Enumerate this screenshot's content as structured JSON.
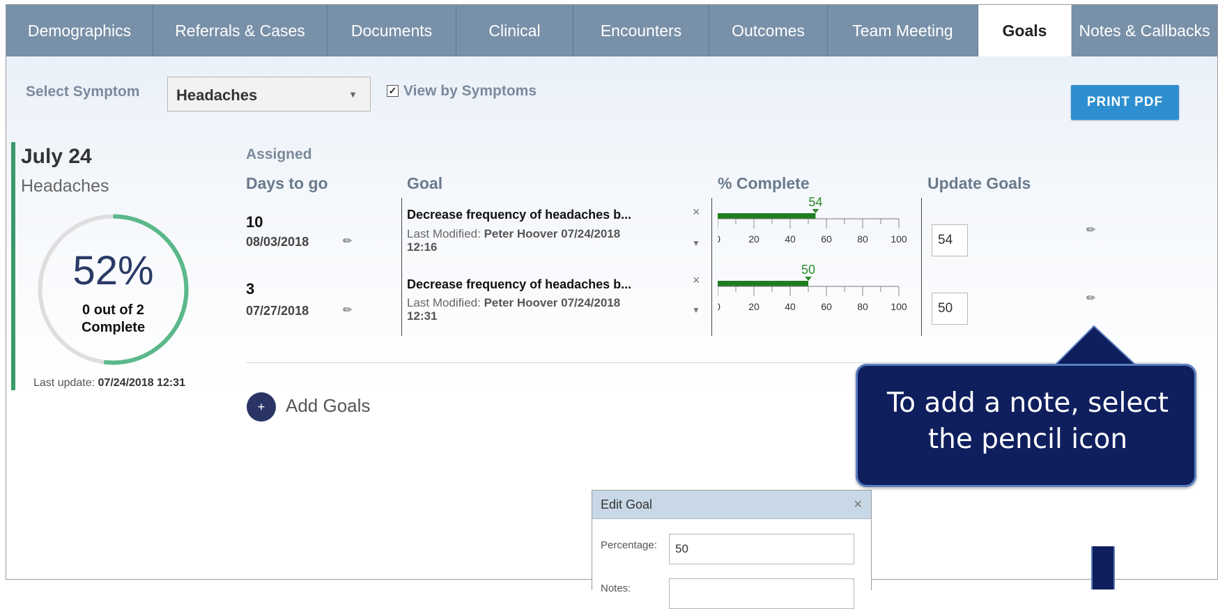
{
  "tabs": [
    "Demographics",
    "Referrals & Cases",
    "Documents",
    "Clinical",
    "Encounters",
    "Outcomes",
    "Team Meeting",
    "Goals",
    "Notes & Callbacks"
  ],
  "active_tab": "Goals",
  "toolbar": {
    "select_label": "Select Symptom",
    "select_value": "Headaches",
    "view_by_symptoms": "View by Symptoms",
    "view_by_symptoms_checked": true,
    "print_pdf": "PRINT PDF"
  },
  "summary": {
    "date": "July 24",
    "symptom": "Headaches",
    "percent": "52%",
    "percent_value": 52,
    "count_line1": "0 out of 2",
    "count_line2": "Complete",
    "last_update_label": "Last update:",
    "last_update_value": "07/24/2018 12:31"
  },
  "table": {
    "assigned_header": "Assigned",
    "days_header": "Days to go",
    "goal_header": "Goal",
    "complete_header": "% Complete",
    "update_header": "Update Goals",
    "scale_ticks": [
      "0",
      "20",
      "40",
      "60",
      "80",
      "100"
    ],
    "rows": [
      {
        "days": "10",
        "due": "08/03/2018",
        "goal": "Decrease frequency of headaches b...",
        "modified_label": "Last Modified:",
        "modified_by": "Peter Hoover 07/24/2018",
        "modified_time": "12:16",
        "percent": 54,
        "percent_label": "54",
        "update_value": "54"
      },
      {
        "days": "3",
        "due": "07/27/2018",
        "goal": "Decrease frequency of headaches b...",
        "modified_label": "Last Modified:",
        "modified_by": "Peter Hoover 07/24/2018",
        "modified_time": "12:31",
        "percent": 50,
        "percent_label": "50",
        "update_value": "50"
      }
    ]
  },
  "add_goals": "Add Goals",
  "dialog": {
    "title": "Edit Goal",
    "percentage_label": "Percentage:",
    "percentage_value": "50",
    "notes_label": "Notes:"
  },
  "callout": {
    "line1": "To add a note, select",
    "line2": "the pencil icon"
  },
  "colors": {
    "tab_bar": "#7890a8",
    "progress": "#1e7d1e",
    "gauge": "#5bb88a",
    "accent_button": "#2d8fd0",
    "callout": "#0f1f5e"
  }
}
